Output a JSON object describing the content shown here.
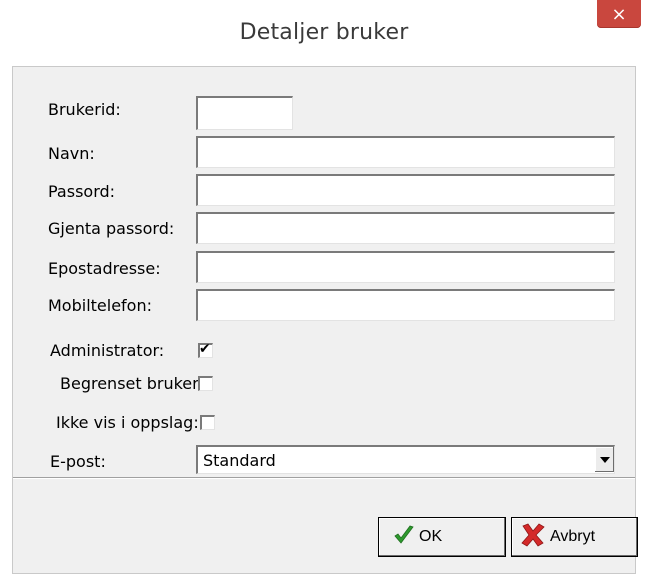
{
  "window": {
    "title": "Detaljer bruker",
    "close_symbol": "×"
  },
  "form": {
    "brukerid": {
      "label": "Brukerid:",
      "value": ""
    },
    "navn": {
      "label": "Navn:",
      "value": ""
    },
    "passord": {
      "label": "Passord:",
      "value": ""
    },
    "gjenta_passord": {
      "label": "Gjenta passord:",
      "value": ""
    },
    "epostadresse": {
      "label": "Epostadresse:",
      "value": ""
    },
    "mobiltelefon": {
      "label": "Mobiltelefon:",
      "value": ""
    },
    "administrator": {
      "label": "Administrator:",
      "checked": true,
      "mark": "✔"
    },
    "begrenset_bruker": {
      "label": "Begrenset bruker:",
      "checked": false
    },
    "ikke_vis": {
      "label": "Ikke vis i oppslag:",
      "checked": false
    },
    "epost": {
      "label": "E-post:",
      "selected": "Standard"
    }
  },
  "buttons": {
    "ok": {
      "label": "OK",
      "icon": "checkmark-icon",
      "color": "#2e9a2e"
    },
    "avbryt": {
      "label": "Avbryt",
      "icon": "red-x-icon",
      "color": "#d42a2a"
    }
  }
}
